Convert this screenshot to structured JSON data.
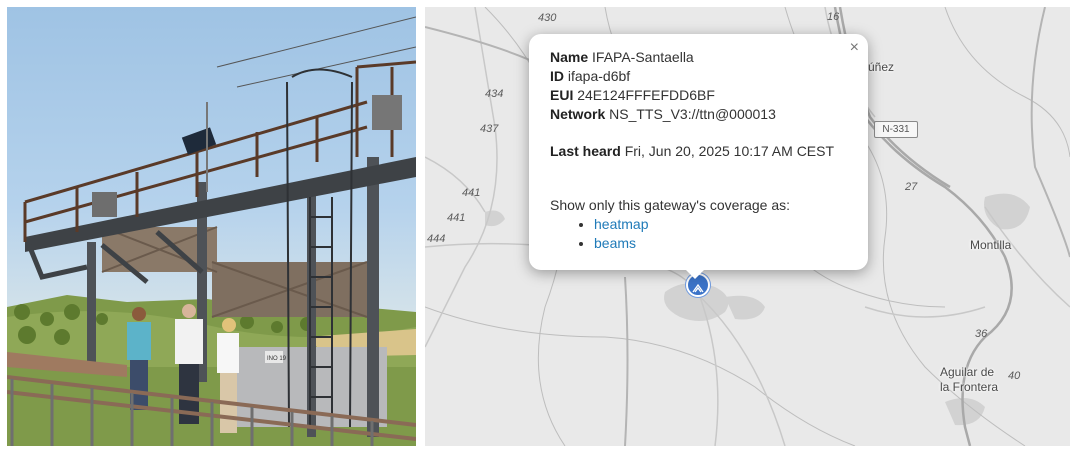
{
  "photo": {
    "sign_text": "INO 19",
    "icon": "field-photo"
  },
  "map": {
    "road_numbers": [
      {
        "label": "430"
      },
      {
        "label": "16"
      },
      {
        "label": "434"
      },
      {
        "label": "437"
      },
      {
        "label": "441"
      },
      {
        "label": "441"
      },
      {
        "label": "444"
      },
      {
        "label": "27"
      },
      {
        "label": "36"
      },
      {
        "label": "40"
      }
    ],
    "highway_shield": "N-331",
    "towns": [
      {
        "label": "úñez"
      },
      {
        "label": "Montilla"
      },
      {
        "label": "Aguilar de"
      },
      {
        "label": "la Frontera"
      }
    ],
    "marker_icon": "gateway-marker-icon",
    "popup": {
      "close_label": "×",
      "name_label": "Name",
      "name_value": "IFAPA-Santaella",
      "id_label": "ID",
      "id_value": "ifapa-d6bf",
      "eui_label": "EUI",
      "eui_value": "24E124FFFEFDD6BF",
      "network_label": "Network",
      "network_value": "NS_TTS_V3://ttn@000013",
      "last_heard_label": "Last heard",
      "last_heard_value": "Fri, Jun 20, 2025 10:17 AM CEST",
      "coverage_prompt": "Show only this gateway's coverage as:",
      "links": [
        {
          "label": "heatmap"
        },
        {
          "label": "beams"
        }
      ]
    }
  }
}
